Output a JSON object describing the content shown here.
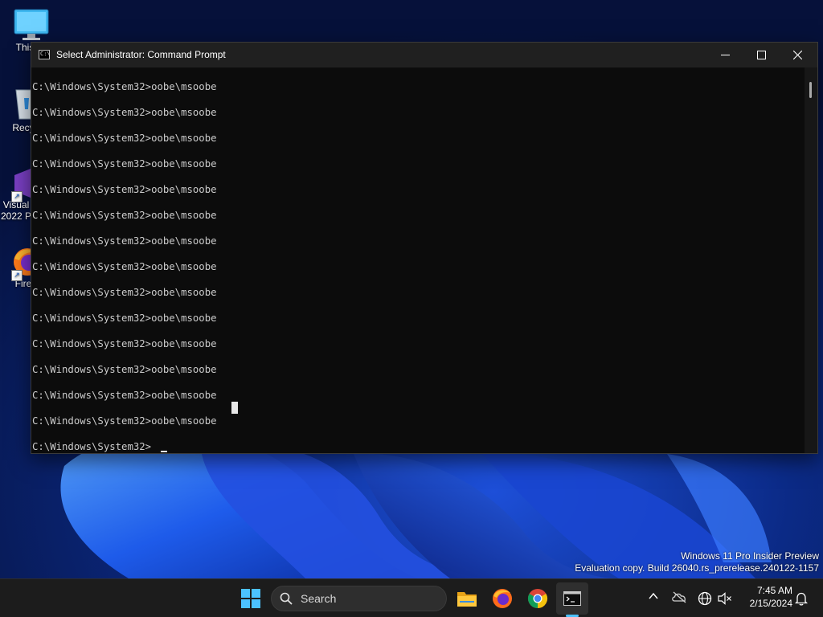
{
  "desktop": {
    "icons": [
      {
        "name": "this-pc",
        "label": "This"
      },
      {
        "name": "recycle-bin",
        "label": "Recyc"
      },
      {
        "name": "visual-studio",
        "label1": "Visual",
        "label2": "2022 P"
      },
      {
        "name": "firefox",
        "label": "Fire"
      }
    ]
  },
  "window": {
    "title": "Select Administrator: Command Prompt",
    "app_icon_text": "C:\\"
  },
  "console": {
    "lines": [
      "C:\\Windows\\System32>oobe\\msoobe",
      "C:\\Windows\\System32>oobe\\msoobe",
      "C:\\Windows\\System32>oobe\\msoobe",
      "C:\\Windows\\System32>oobe\\msoobe",
      "C:\\Windows\\System32>oobe\\msoobe",
      "C:\\Windows\\System32>oobe\\msoobe",
      "C:\\Windows\\System32>oobe\\msoobe",
      "C:\\Windows\\System32>oobe\\msoobe",
      "C:\\Windows\\System32>oobe\\msoobe",
      "C:\\Windows\\System32>oobe\\msoobe",
      "C:\\Windows\\System32>oobe\\msoobe",
      "C:\\Windows\\System32>oobe\\msoobe",
      "C:\\Windows\\System32>oobe\\msoobe",
      "C:\\Windows\\System32>oobe\\msoobe",
      "C:\\Windows\\System32>"
    ]
  },
  "watermark": {
    "line1": "Windows 11 Pro Insider Preview",
    "line2": "Evaluation copy. Build 26040.rs_prerelease.240122-1157"
  },
  "taskbar": {
    "search_placeholder": "Search",
    "time": "7:45 AM",
    "date": "2/15/2024",
    "accent": "#4cc2ff"
  }
}
